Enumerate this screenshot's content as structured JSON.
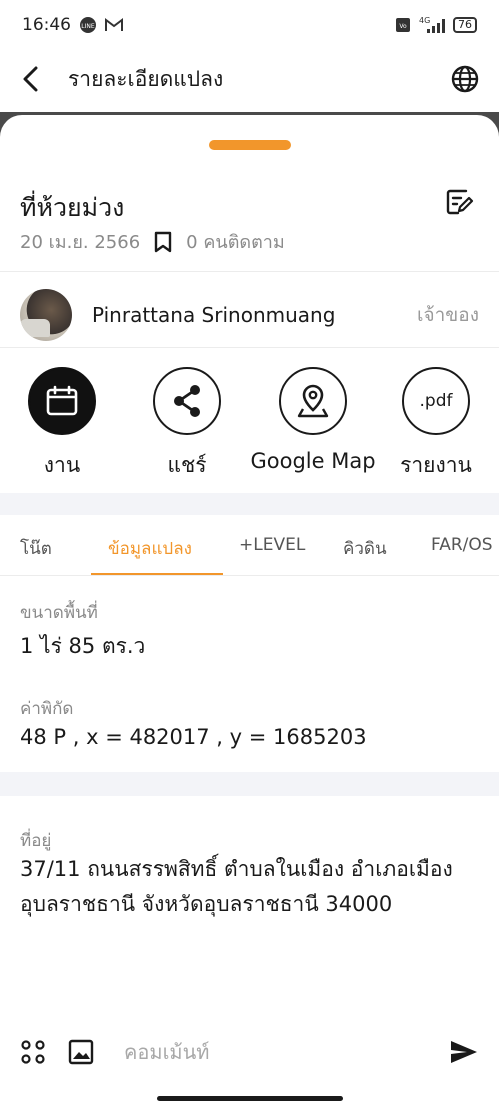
{
  "status_bar": {
    "time": "16:46",
    "network": "4G",
    "battery": "76"
  },
  "app_bar": {
    "title": "รายละเอียดแปลง"
  },
  "plot": {
    "title": "ที่ห้วยม่วง",
    "date": "20 เม.ย. 2566",
    "followers": "0 คนติดตาม"
  },
  "owner": {
    "name": "Pinrattana Srinonmuang",
    "role": "เจ้าของ"
  },
  "actions": [
    {
      "label": "งาน",
      "icon": "calendar-icon"
    },
    {
      "label": "แชร์",
      "icon": "share-icon"
    },
    {
      "label": "Google Map",
      "icon": "map-pin-icon"
    },
    {
      "label": "รายงาน",
      "icon": "pdf-icon",
      "icon_text": ".pdf"
    }
  ],
  "tabs": [
    {
      "label": "โน๊ต",
      "active": false
    },
    {
      "label": "ข้อมูลแปลง",
      "active": true
    },
    {
      "label": "+LEVEL",
      "active": false
    },
    {
      "label": "คิวดิน",
      "active": false
    },
    {
      "label": "FAR/OS",
      "active": false
    }
  ],
  "details": {
    "area_label": "ขนาดพื้นที่",
    "area_value": "1 ไร่ 85 ตร.ว",
    "coord_label": "ค่าพิกัด",
    "coord_value": "48 P , x = 482017 , y = 1685203",
    "address_label": "ที่อยู่",
    "address_value": "37/11 ถนนสรรพสิทธิ์ ตำบลในเมือง อำเภอเมือง อุบลราชธานี จังหวัดอุบลราชธานี 34000"
  },
  "comment": {
    "placeholder": "คอมเม้นท์"
  },
  "colors": {
    "accent": "#f2962b",
    "text": "#1a1a1a",
    "muted": "#8a8a8a",
    "band": "#f3f4f8"
  }
}
